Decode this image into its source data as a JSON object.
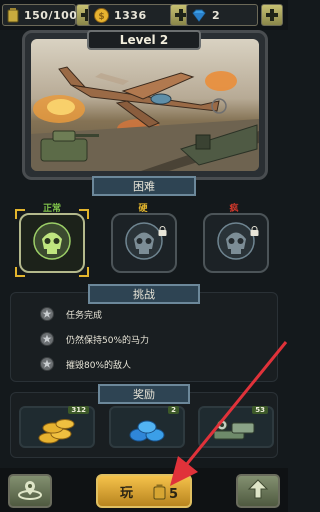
{
  "topbar": {
    "energy": "150/100",
    "coins": "1336",
    "gems": "2"
  },
  "level": {
    "title": "Level 2"
  },
  "difficulty": {
    "section_label": "困难",
    "levels": [
      {
        "name": "正常",
        "color": "#7fc24a",
        "selected": true,
        "locked": false
      },
      {
        "name": "硬",
        "color": "#e3b52d",
        "selected": false,
        "locked": true
      },
      {
        "name": "疯",
        "color": "#d0382b",
        "selected": false,
        "locked": true
      }
    ]
  },
  "challenge": {
    "section_label": "挑战",
    "items": [
      "任务完成",
      "仍然保持50%的马力",
      "摧毁80%的敌人"
    ]
  },
  "rewards": {
    "section_label": "奖励",
    "items": [
      {
        "icon": "gold-coins-icon",
        "count": "312"
      },
      {
        "icon": "blue-gems-icon",
        "count": "2"
      },
      {
        "icon": "weapon-parts-icon",
        "count": "53"
      }
    ]
  },
  "bottom": {
    "play_label": "玩",
    "play_cost": "5"
  }
}
